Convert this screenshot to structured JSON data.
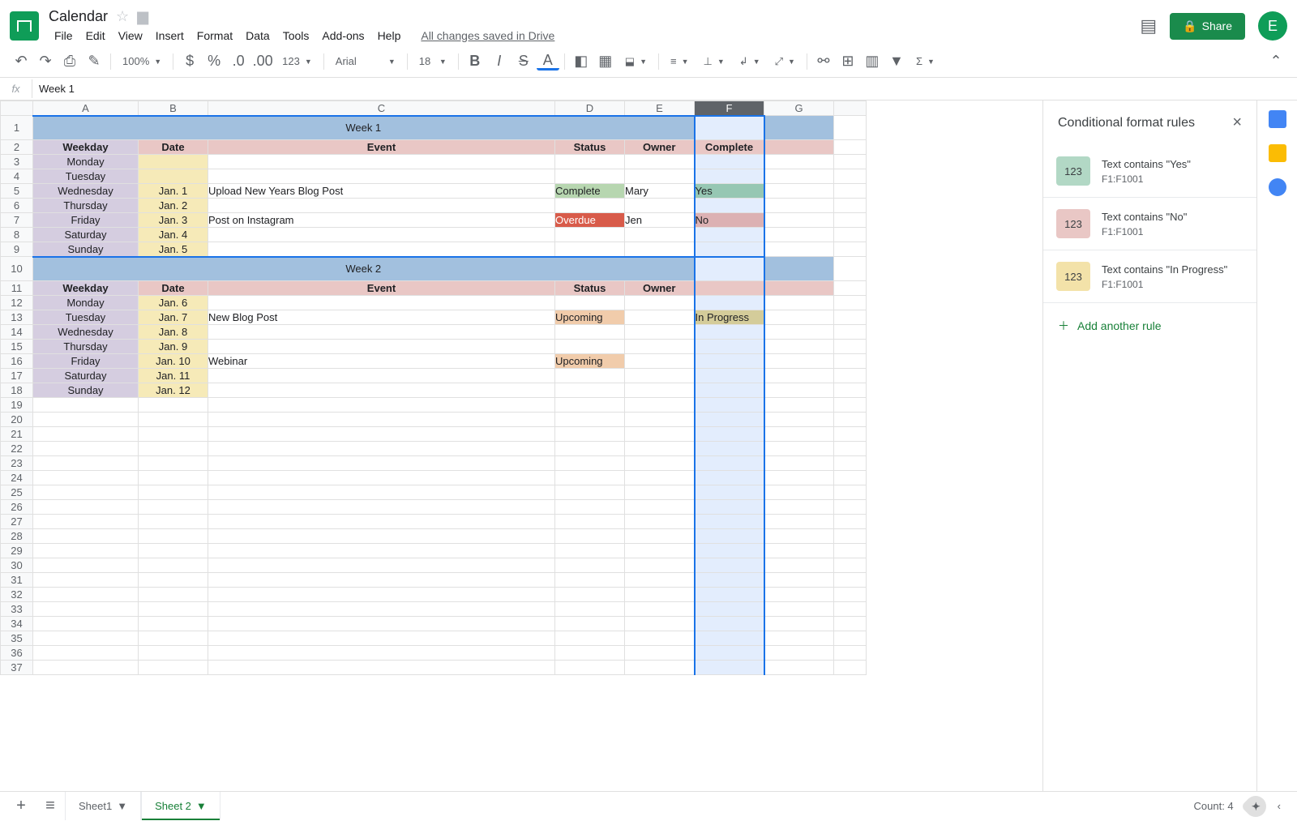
{
  "doc": {
    "name": "Calendar",
    "saved": "All changes saved in Drive"
  },
  "menus": [
    "File",
    "Edit",
    "View",
    "Insert",
    "Format",
    "Data",
    "Tools",
    "Add-ons",
    "Help"
  ],
  "toolbar": {
    "zoom": "100%",
    "font": "Arial",
    "size": "18",
    "numfmt": "123",
    "currency": "$",
    "percent": "%",
    "dec_dec": ".0",
    "dec_inc": ".00"
  },
  "share": {
    "label": "Share",
    "avatar": "E"
  },
  "fx": {
    "label": "fx",
    "value": "Week 1"
  },
  "columns": [
    "A",
    "B",
    "C",
    "D",
    "E",
    "F",
    "G"
  ],
  "selected_col": "F",
  "sheet": {
    "week1": {
      "banner": "Week 1",
      "headers": {
        "weekday": "Weekday",
        "date": "Date",
        "event": "Event",
        "status": "Status",
        "owner": "Owner",
        "complete": "Complete"
      },
      "rows": [
        {
          "weekday": "Monday",
          "date": "",
          "event": "",
          "status": "",
          "owner": "",
          "complete": ""
        },
        {
          "weekday": "Tuesday",
          "date": "",
          "event": "",
          "status": "",
          "owner": "",
          "complete": ""
        },
        {
          "weekday": "Wednesday",
          "date": "Jan. 1",
          "event": "Upload New Years Blog Post",
          "status": "Complete",
          "owner": "Mary",
          "complete": "Yes"
        },
        {
          "weekday": "Thursday",
          "date": "Jan. 2",
          "event": "",
          "status": "",
          "owner": "",
          "complete": ""
        },
        {
          "weekday": "Friday",
          "date": "Jan. 3",
          "event": "Post on Instagram",
          "status": "Overdue",
          "owner": "Jen",
          "complete": "No"
        },
        {
          "weekday": "Saturday",
          "date": "Jan. 4",
          "event": "",
          "status": "",
          "owner": "",
          "complete": ""
        },
        {
          "weekday": "Sunday",
          "date": "Jan. 5",
          "event": "",
          "status": "",
          "owner": "",
          "complete": ""
        }
      ]
    },
    "week2": {
      "banner": "Week 2",
      "headers": {
        "weekday": "Weekday",
        "date": "Date",
        "event": "Event",
        "status": "Status",
        "owner": "Owner",
        "complete": ""
      },
      "rows": [
        {
          "weekday": "Monday",
          "date": "Jan. 6",
          "event": "",
          "status": "",
          "owner": "",
          "complete": ""
        },
        {
          "weekday": "Tuesday",
          "date": "Jan. 7",
          "event": "New Blog Post",
          "status": "Upcoming",
          "owner": "",
          "complete": "In Progress"
        },
        {
          "weekday": "Wednesday",
          "date": "Jan. 8",
          "event": "",
          "status": "",
          "owner": "",
          "complete": ""
        },
        {
          "weekday": "Thursday",
          "date": "Jan. 9",
          "event": "",
          "status": "",
          "owner": "",
          "complete": ""
        },
        {
          "weekday": "Friday",
          "date": "Jan. 10",
          "event": "Webinar",
          "status": "Upcoming",
          "owner": "",
          "complete": ""
        },
        {
          "weekday": "Saturday",
          "date": "Jan. 11",
          "event": "",
          "status": "",
          "owner": "",
          "complete": ""
        },
        {
          "weekday": "Sunday",
          "date": "Jan. 12",
          "event": "",
          "status": "",
          "owner": "",
          "complete": ""
        }
      ]
    }
  },
  "side": {
    "title": "Conditional format rules",
    "rules": [
      {
        "swatch": "#b2d8c5",
        "sample": "123",
        "text": "Text contains \"Yes\"",
        "range": "F1:F1001"
      },
      {
        "swatch": "#e9c7c5",
        "sample": "123",
        "text": "Text contains \"No\"",
        "range": "F1:F1001"
      },
      {
        "swatch": "#f3e2a9",
        "sample": "123",
        "text": "Text contains \"In Progress\"",
        "range": "F1:F1001"
      }
    ],
    "add": "Add another rule"
  },
  "tabs": {
    "sheet1": "Sheet1",
    "sheet2": "Sheet 2",
    "count": "Count: 4"
  }
}
